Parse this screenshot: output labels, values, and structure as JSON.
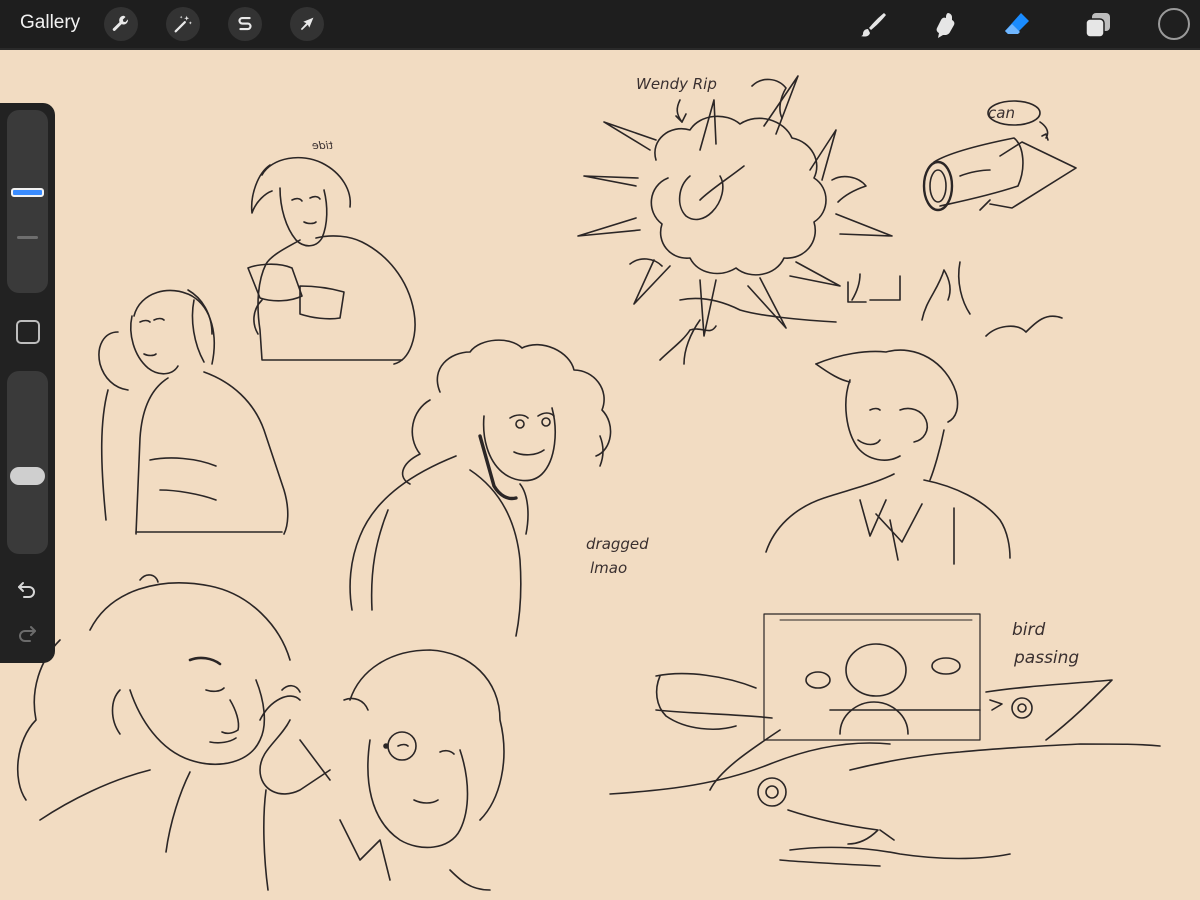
{
  "toolbar": {
    "gallery_label": "Gallery",
    "left_tools": [
      {
        "name": "actions",
        "icon": "wrench-icon"
      },
      {
        "name": "adjustments",
        "icon": "magic-wand-icon"
      },
      {
        "name": "selection",
        "icon": "selection-s-icon"
      },
      {
        "name": "transform",
        "icon": "arrow-cursor-icon"
      }
    ],
    "right_tools": [
      {
        "name": "brush",
        "icon": "brush-icon",
        "active": false
      },
      {
        "name": "smudge",
        "icon": "smudge-icon",
        "active": false
      },
      {
        "name": "eraser",
        "icon": "eraser-icon",
        "active": true
      },
      {
        "name": "layers",
        "icon": "layers-icon",
        "active": false
      }
    ],
    "current_color": "#1f1f1f",
    "accent_color": "#1a8cff"
  },
  "sidebar": {
    "brush_size_level": 0.55,
    "brush_opacity_level": 0.42
  },
  "canvas": {
    "background_color": "#f2dcc2",
    "annotations": {
      "wendy_rip": "Wendy Rip",
      "can": "can",
      "tide": "tide",
      "dragged_line1": "dragged",
      "dragged_line2": "lmao",
      "bird_line1": "bird",
      "bird_line2": "passing"
    }
  }
}
